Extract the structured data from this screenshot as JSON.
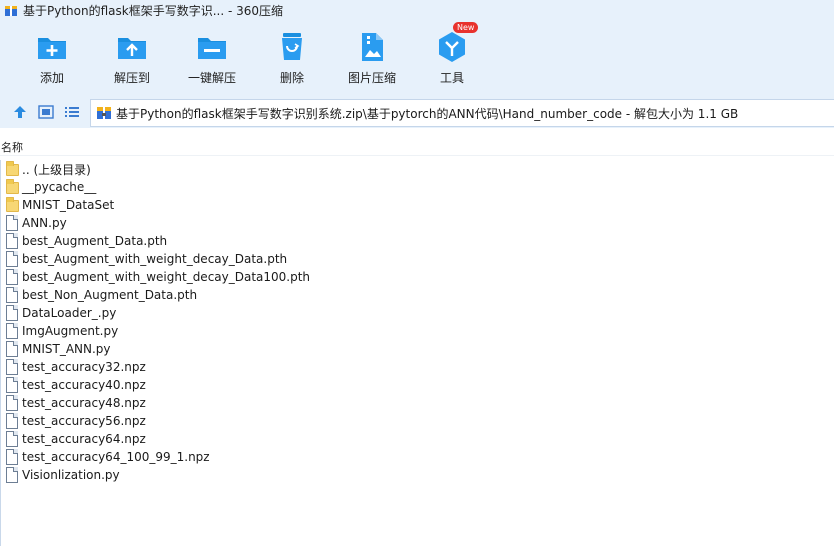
{
  "window": {
    "title": "基于Python的flask框架手写数字识... - 360压缩"
  },
  "toolbar": {
    "items": [
      {
        "label": "添加",
        "icon": "add-icon"
      },
      {
        "label": "解压到",
        "icon": "extract-to-icon"
      },
      {
        "label": "一键解压",
        "icon": "one-click-extract-icon"
      },
      {
        "label": "删除",
        "icon": "delete-icon"
      },
      {
        "label": "图片压缩",
        "icon": "image-compress-icon"
      },
      {
        "label": "工具",
        "icon": "tools-icon",
        "badge": "New"
      }
    ]
  },
  "addressbar": {
    "path": "基于Python的flask框架手写数字识别系统.zip\\基于pytorch的ANN代码\\Hand_number_code - 解包大小为 1.1 GB"
  },
  "list": {
    "column_name": "名称",
    "files": [
      {
        "name": ".. (上级目录)",
        "type": "folder"
      },
      {
        "name": "__pycache__",
        "type": "folder"
      },
      {
        "name": "MNIST_DataSet",
        "type": "folder"
      },
      {
        "name": "ANN.py",
        "type": "file"
      },
      {
        "name": "best_Augment_Data.pth",
        "type": "file"
      },
      {
        "name": "best_Augment_with_weight_decay_Data.pth",
        "type": "file"
      },
      {
        "name": "best_Augment_with_weight_decay_Data100.pth",
        "type": "file"
      },
      {
        "name": "best_Non_Augment_Data.pth",
        "type": "file"
      },
      {
        "name": "DataLoader_.py",
        "type": "file"
      },
      {
        "name": "ImgAugment.py",
        "type": "file"
      },
      {
        "name": "MNIST_ANN.py",
        "type": "file"
      },
      {
        "name": "test_accuracy32.npz",
        "type": "file"
      },
      {
        "name": "test_accuracy40.npz",
        "type": "file"
      },
      {
        "name": "test_accuracy48.npz",
        "type": "file"
      },
      {
        "name": "test_accuracy56.npz",
        "type": "file"
      },
      {
        "name": "test_accuracy64.npz",
        "type": "file"
      },
      {
        "name": "test_accuracy64_100_99_1.npz",
        "type": "file"
      },
      {
        "name": "Visionlization.py",
        "type": "file"
      }
    ]
  },
  "colors": {
    "toolbar_bg": "#e7f1fb",
    "icon_blue": "#1a8fe0",
    "badge_red": "#e8322d",
    "folder_yellow": "#f7d774"
  }
}
